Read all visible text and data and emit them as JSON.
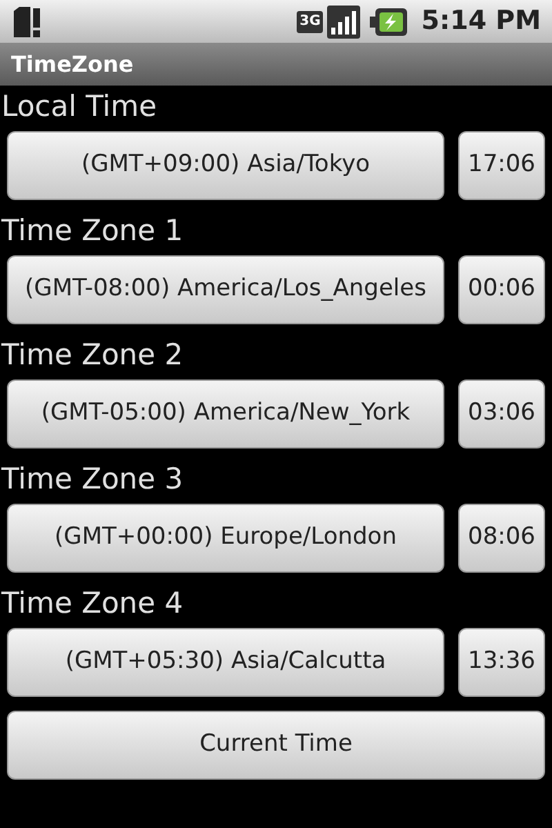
{
  "status_bar": {
    "network_type": "3G",
    "time": "5:14 PM"
  },
  "window": {
    "title": "TimeZone"
  },
  "zones": [
    {
      "label": "Local Time",
      "zone": "(GMT+09:00) Asia/Tokyo",
      "time": "17:06"
    },
    {
      "label": "Time Zone 1",
      "zone": "(GMT-08:00) America/Los_Angeles",
      "time": "00:06"
    },
    {
      "label": "Time Zone 2",
      "zone": "(GMT-05:00) America/New_York",
      "time": "03:06"
    },
    {
      "label": "Time Zone 3",
      "zone": "(GMT+00:00) Europe/London",
      "time": "08:06"
    },
    {
      "label": "Time Zone 4",
      "zone": "(GMT+05:30) Asia/Calcutta",
      "time": "13:36"
    }
  ],
  "button": "Current Time"
}
